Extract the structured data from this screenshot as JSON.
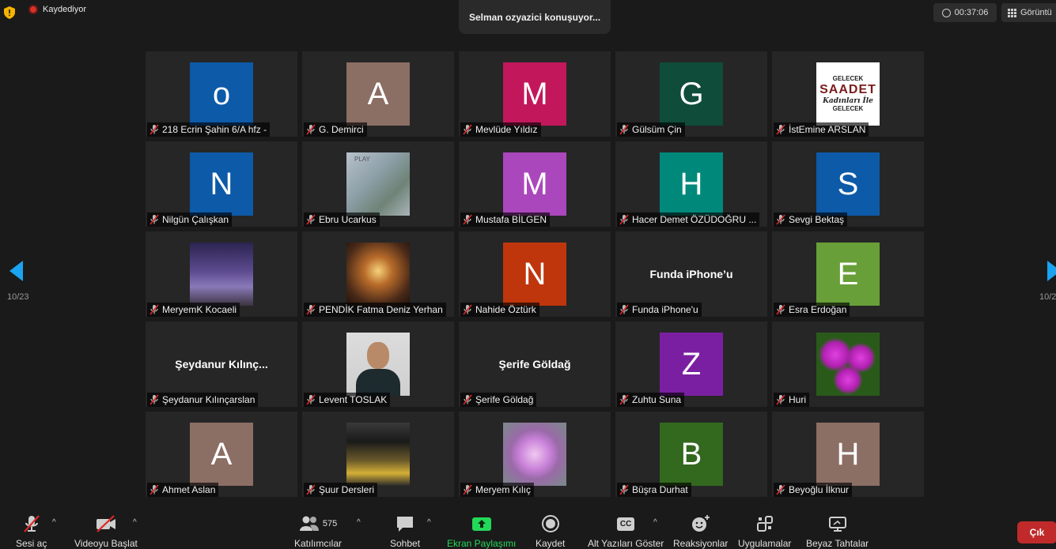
{
  "topbar": {
    "recording_label": "Kaydediyor",
    "speaker_status": "Selman ozyazici konuşuyor...",
    "timer": "00:37:06",
    "view_label": "Görüntü"
  },
  "pagination": {
    "left_page": "10/23",
    "right_page": "10/2"
  },
  "participants": [
    {
      "name": "218 Ecrin Şahin 6/A hfz -",
      "avatar": "o",
      "color": "#0d5aa8"
    },
    {
      "name": "G. Demirci",
      "avatar": "A",
      "color": "#8b6e64"
    },
    {
      "name": "Mevlüde Yıldız",
      "avatar": "M",
      "color": "#c2185b"
    },
    {
      "name": "Gülsüm Çin",
      "avatar": "G",
      "color": "#0f4c3a"
    },
    {
      "name": "İstEmine ARSLAN",
      "image_text": [
        "GELECEK",
        "SAADET",
        "Kadınları İle",
        "GELECEK"
      ]
    },
    {
      "name": "Nilgün Çalışkan",
      "avatar": "N",
      "color": "#0d5aa8"
    },
    {
      "name": "Ebru Ucarkus",
      "image_text": [
        "PLAY"
      ]
    },
    {
      "name": "Mustafa BİLGEN",
      "avatar": "M",
      "color": "#ab47bc"
    },
    {
      "name": "Hacer Demet ÖZÜDOĞRU ...",
      "avatar": "H",
      "color": "#00897b"
    },
    {
      "name": "Sevgi Bektaş",
      "avatar": "S",
      "color": "#0d5aa8"
    },
    {
      "name": "MeryemK Kocaeli"
    },
    {
      "name": "PENDİK Fatma Deniz Yerhan"
    },
    {
      "name": "Nahide Öztürk",
      "avatar": "N",
      "color": "#bf360c"
    },
    {
      "name": "Funda iPhone'u",
      "display_name": "Funda iPhone’u"
    },
    {
      "name": "Esra Erdoğan",
      "avatar": "E",
      "color": "#689f38"
    },
    {
      "name": "Şeydanur Kılınçarslan",
      "display_name": "Şeydanur  Kılınç..."
    },
    {
      "name": "Levent TOSLAK"
    },
    {
      "name": "Şerife Göldağ",
      "display_name": "Şerife Göldağ"
    },
    {
      "name": "Zuhtu Suna",
      "avatar": "Z",
      "color": "#7b1fa2"
    },
    {
      "name": "Huri"
    },
    {
      "name": "Ahmet Aslan",
      "avatar": "A",
      "color": "#8b6e64"
    },
    {
      "name": "Şuur Dersleri"
    },
    {
      "name": "Meryem Kılıç"
    },
    {
      "name": "Büşra Durhat",
      "avatar": "B",
      "color": "#33691e"
    },
    {
      "name": "Beyoğlu İlknur",
      "avatar": "H",
      "color": "#8b6e64"
    }
  ],
  "toolbar": {
    "mute": "Sesi aç",
    "video": "Videoyu Başlat",
    "participants": "Katılımcılar",
    "participant_count": "575",
    "chat": "Sohbet",
    "share": "Ekran Paylaşımı",
    "record": "Kaydet",
    "captions": "Alt Yazıları Göster",
    "captions_icon_text": "CC",
    "reactions": "Reaksiyonlar",
    "apps": "Uygulamalar",
    "whiteboards": "Beyaz Tahtalar",
    "leave": "Çık"
  },
  "colors": {
    "accent_blue": "#1aa3f0",
    "leave_red": "#c02a2a",
    "share_green": "#23d959",
    "mic_muted_red": "#e02828"
  }
}
